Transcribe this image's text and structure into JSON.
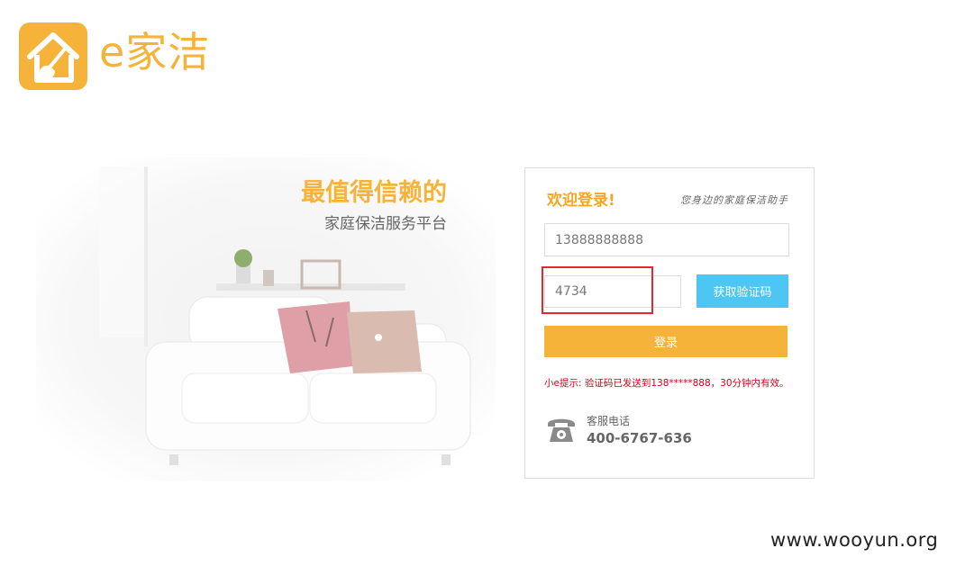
{
  "brand": {
    "logo_text": "e家洁",
    "color": "#f6b33a"
  },
  "hero": {
    "title": "最值得信赖的",
    "subtitle": "家庭保洁服务平台"
  },
  "login": {
    "welcome": "欢迎登录!",
    "slogan": "您身边的家庭保洁助手",
    "phone_value": "13888888888",
    "code_value": "4734",
    "sms_button_label": "获取验证码",
    "login_button_label": "登录",
    "hint": "小e提示: 验证码已发送到138*****888，30分钟内有效。",
    "service_label": "客服电话",
    "service_number": "400-6767-636"
  },
  "colors": {
    "accent": "#f6b33a",
    "sms_button": "#4dc6f3",
    "hint_text": "#d0021b",
    "highlight_box": "#e8262e"
  },
  "icons": [
    "house-broom-icon",
    "telephone-icon"
  ],
  "watermark": "www.wooyun.org"
}
